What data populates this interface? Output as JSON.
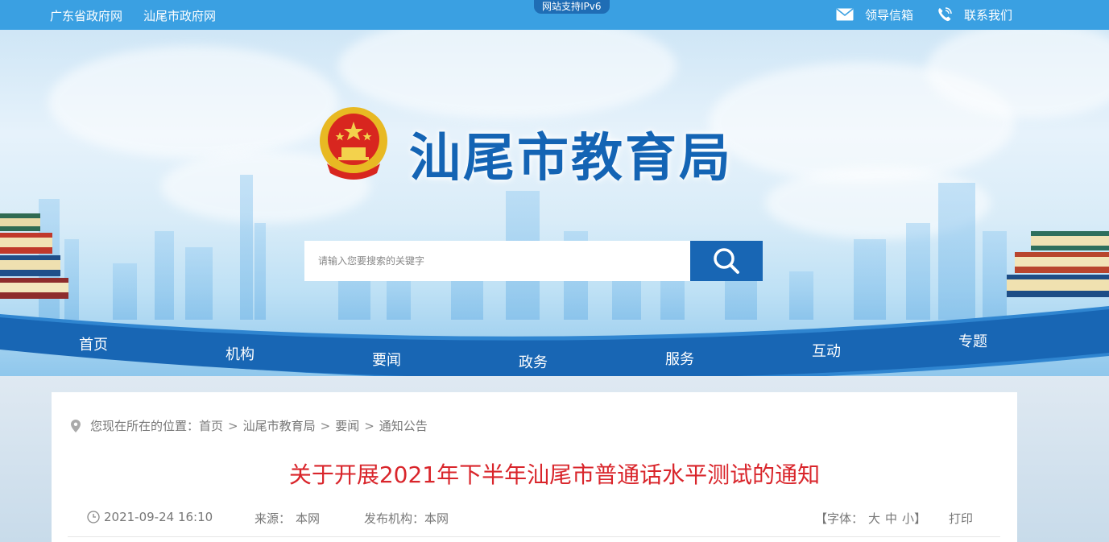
{
  "topbar": {
    "links": [
      "广东省政府网",
      "汕尾市政府网"
    ],
    "ipv6_badge": "网站支持IPv6",
    "mailbox_label": "领导信箱",
    "contact_label": "联系我们"
  },
  "banner": {
    "site_title": "汕尾市教育局",
    "search_placeholder": "请输入您要搜索的关键字"
  },
  "nav": [
    "首页",
    "机构",
    "要闻",
    "政务",
    "服务",
    "互动",
    "专题"
  ],
  "breadcrumb": {
    "prefix": "您现在所在的位置：",
    "items": [
      "首页",
      "汕尾市教育局",
      "要闻",
      "通知公告"
    ],
    "separator": ">"
  },
  "article": {
    "title": "关于开展2021年下半年汕尾市普通话水平测试的通知",
    "datetime": "2021-09-24 16:10",
    "source_label": "来源：",
    "source_value": "本网",
    "publisher_label": "发布机构：",
    "publisher_value": "本网",
    "font_size_prefix": "【字体：",
    "font_large": "大",
    "font_medium": "中",
    "font_small": "小",
    "font_size_suffix": "】",
    "print_label": "打印"
  },
  "colors": {
    "topbar": "#3aa0e2",
    "nav_band": "#1866b4",
    "title_red": "#d9252b",
    "site_title_blue": "#1464b4"
  }
}
